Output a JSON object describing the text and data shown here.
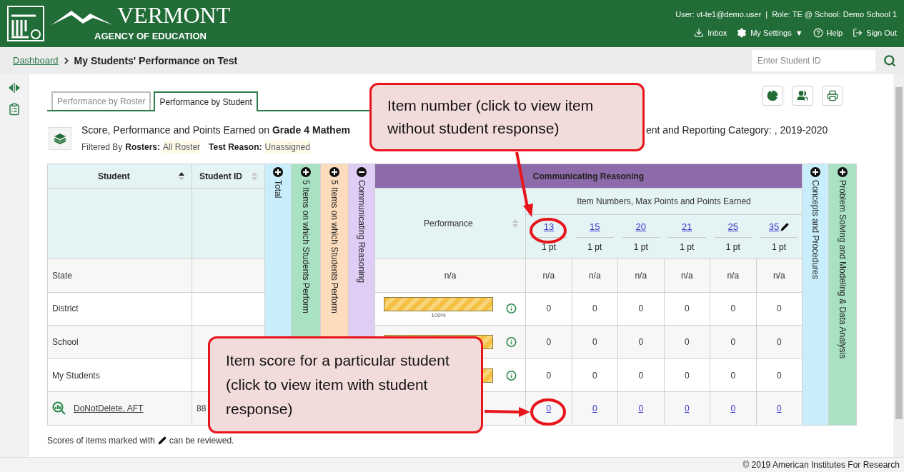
{
  "header": {
    "logo_title": "VERMONT",
    "logo_subtitle": "AGENCY OF EDUCATION",
    "user": "User: vt-te1@demo.user",
    "separator": "|",
    "role": "Role: TE @ School: Demo School 1",
    "links": [
      {
        "kind": "inbox",
        "label": "Inbox"
      },
      {
        "kind": "settings",
        "label": "My Settings",
        "caret": "▼"
      },
      {
        "kind": "help",
        "label": "Help"
      },
      {
        "kind": "signout",
        "label": "Sign Out"
      }
    ]
  },
  "breadcrumb": {
    "link": "Dashboard",
    "current": "My Students' Performance on Test"
  },
  "search": {
    "placeholder": "Enter Student ID"
  },
  "tabs": [
    {
      "label": "Performance by Roster",
      "selected": false
    },
    {
      "label": "Performance by Student",
      "selected": true
    }
  ],
  "report": {
    "title_start": "Score, Performance and Points Earned on **Grade 4 Mathem**",
    "title_end": "ent and Reporting Category: , 2019-2020",
    "filtered_by": "Filtered By",
    "filters": [
      {
        "label": "Rosters:",
        "value": "All Roster"
      },
      {
        "label": "Test Reason:",
        "value": "Unassigned"
      }
    ]
  },
  "table": {
    "student_header": "Student",
    "student_sorted": true,
    "student_id_header": "Student ID",
    "student_id_sorted": false,
    "left_groups": [
      {
        "label": "Total",
        "color": "#c8eefb",
        "expanded": false
      },
      {
        "label": "5 Items on which Students Perform",
        "color": "#a9e2c3",
        "expanded": false
      },
      {
        "label": "5 Items on which Students Perform",
        "color": "#fcdcbc",
        "expanded": false
      },
      {
        "label": "Communicating Reasoning",
        "color": "#dfcdf6",
        "expanded": true
      }
    ],
    "group": {
      "title": "Communicating Reasoning",
      "subtitle": "Item Numbers, Max Points and Points Earned",
      "performance_header": "Performance",
      "performance_sorted": false,
      "items": [
        {
          "number": "13",
          "max": "1 pt",
          "reviewable": false
        },
        {
          "number": "15",
          "max": "1 pt",
          "reviewable": false
        },
        {
          "number": "20",
          "max": "1 pt",
          "reviewable": false
        },
        {
          "number": "21",
          "max": "1 pt",
          "reviewable": false
        },
        {
          "number": "25",
          "max": "1 pt",
          "reviewable": false
        },
        {
          "number": "35",
          "max": "1 pt",
          "reviewable": true
        }
      ]
    },
    "right_groups": [
      {
        "label": "Concepts and Procedures",
        "color": "#c8eefb",
        "expanded": false
      },
      {
        "label": "Problem Solving and Modeling & Data Analysis",
        "color": "#a9e2c3",
        "expanded": false
      }
    ],
    "rows": [
      {
        "kind": "aggregate",
        "name": "State",
        "performance": {
          "text": "n/a"
        },
        "scores": [
          "n/a",
          "n/a",
          "n/a",
          "n/a",
          "n/a",
          "n/a"
        ]
      },
      {
        "kind": "aggregate",
        "name": "District",
        "performance": {
          "level": 1,
          "label": "100%"
        },
        "scores": [
          "0",
          "0",
          "0",
          "0",
          "0",
          "0"
        ]
      },
      {
        "kind": "aggregate",
        "name": "School",
        "performance": {
          "level": 1
        },
        "scores": [
          "0",
          "0",
          "0",
          "0",
          "0",
          "0"
        ]
      },
      {
        "kind": "aggregate",
        "name": "My Students",
        "performance": {
          "level": 1
        },
        "scores": [
          "0",
          "0",
          "0",
          "0",
          "0",
          "0"
        ]
      },
      {
        "kind": "student",
        "name": "DoNotDelete, AFT",
        "student_id": "88",
        "scores": [
          "0",
          "0",
          "0",
          "0",
          "0",
          "0"
        ]
      }
    ]
  },
  "footnote": {
    "before": "Scores of items marked with",
    "after": "can be reviewed."
  },
  "footer": "© 2019 American Institutes For Research",
  "callouts": [
    {
      "text": "Item number (click to view item without student response)"
    },
    {
      "text": "Item score for a particular student (click to view item with student response)"
    }
  ]
}
